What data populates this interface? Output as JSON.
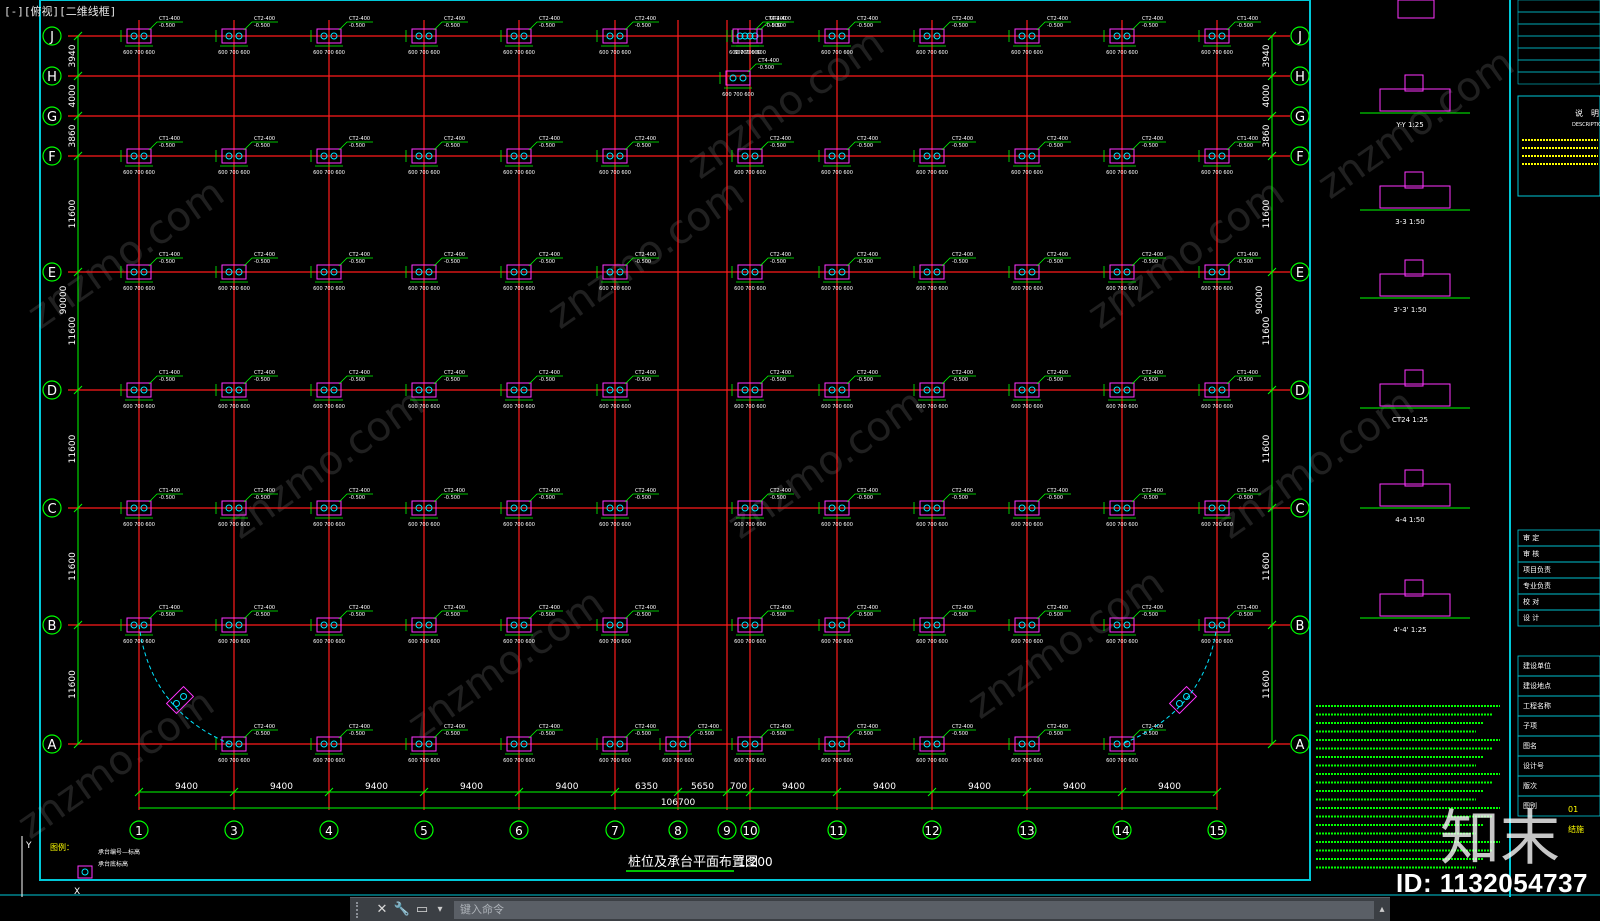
{
  "viewport": {
    "label": "[-][俯视][二维线框]"
  },
  "grid": {
    "row_labels": [
      "J",
      "H",
      "G",
      "F",
      "E",
      "D",
      "C",
      "B",
      "A"
    ],
    "col_labels": [
      "1",
      "3",
      "4",
      "5",
      "6",
      "7",
      "8",
      "9",
      "10",
      "11",
      "12",
      "13",
      "14",
      "15"
    ],
    "left_dims": [
      "3940",
      "4000",
      "3860",
      "11600",
      "11600",
      "11600",
      "11600",
      "11600"
    ],
    "right_dims": [
      "3940",
      "4000",
      "3860",
      "11600",
      "11600",
      "11600",
      "11600",
      "11600"
    ],
    "total_vertical": "90000",
    "bottom_dims": [
      "9400",
      "9400",
      "9400",
      "9400",
      "9400",
      "6350",
      "5650",
      "700",
      "9400",
      "9400",
      "9400",
      "9400",
      "9400"
    ],
    "total_horizontal": "106700"
  },
  "cap_labels": {
    "tag_ct1": "CT1-400",
    "tag_ct2": "CT2-400",
    "tag_ct4": "CT4-400",
    "elev": "-0.500",
    "dims": "600 700 600"
  },
  "drawing_title": "桩位及承台平面布置图",
  "drawing_scale": "1:200",
  "title_note": "图例：",
  "legend_note": "承台编号—标高",
  "legend_note2": "承台底标高",
  "details": [
    {
      "label": "Y-Y 1:25"
    },
    {
      "label": "3-3 1:50"
    },
    {
      "label": "3'-3' 1:50"
    },
    {
      "label": "CT24 1:25"
    },
    {
      "label": "4-4 1:50"
    },
    {
      "label": "4'-4' 1:25"
    }
  ],
  "title_block": {
    "description_header": "说　明",
    "description_en": "DESCRIPTION",
    "rows": [
      "审 定",
      "审 核",
      "项目负责",
      "专业负责",
      "校 对",
      "设 计"
    ],
    "project_rows": [
      "建设单位",
      "建设地点",
      "工程名称",
      "子项",
      "图名",
      "设计号",
      "版次",
      "图别"
    ],
    "version": "01",
    "category": "结施"
  },
  "command": {
    "placeholder": "键入命令"
  },
  "watermark": {
    "logo": "知末",
    "id_text": "ID: 1132054737",
    "site": "znzmo.com"
  },
  "colors": {
    "grid_red": "#ff1a1a",
    "dim_green": "#00ff00",
    "border_cyan": "#00c8d8",
    "pile_cyan": "#00e5ff",
    "pile_magenta": "#ff33ff",
    "label_white": "#ffffff",
    "label_yellow": "#ffff00"
  }
}
